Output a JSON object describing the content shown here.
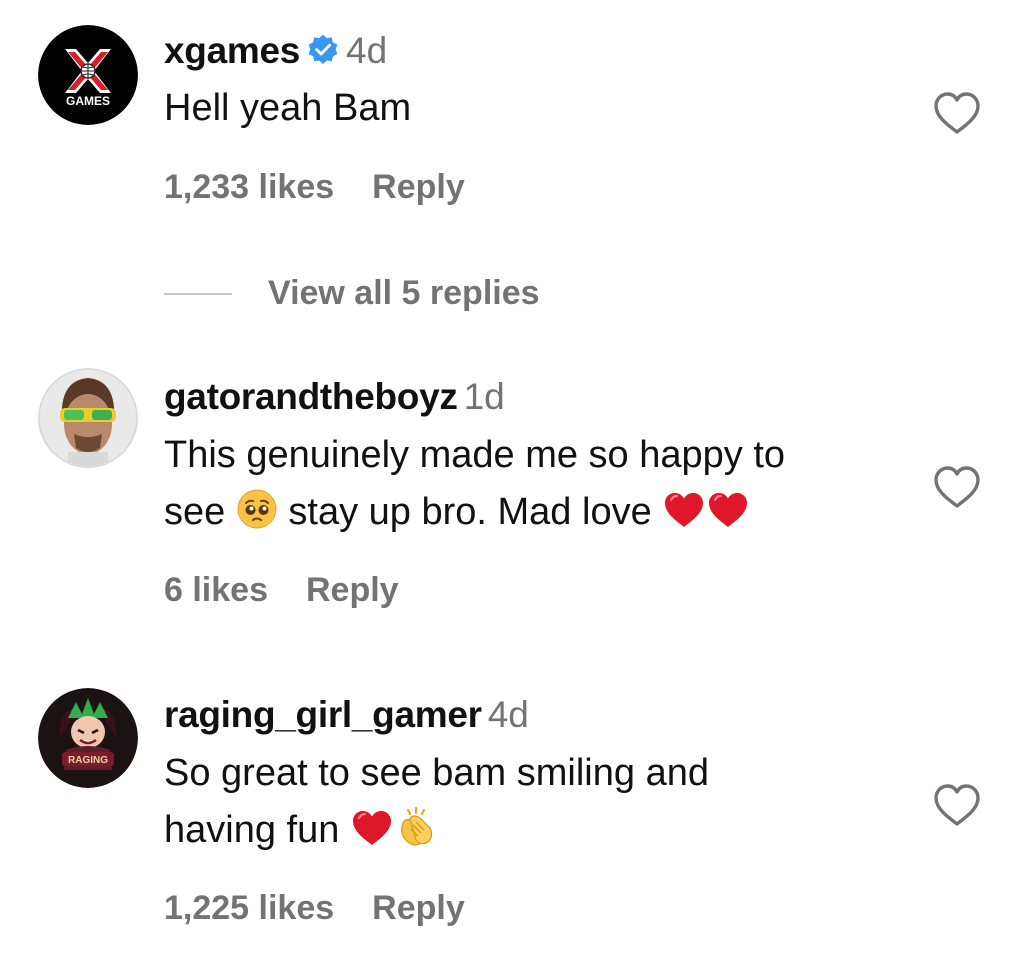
{
  "comments": [
    {
      "username": "xgames",
      "verified": true,
      "time": "4d",
      "text_lines": [
        "Hell yeah Bam"
      ],
      "likes": "1,233 likes",
      "reply_label": "Reply",
      "avatar_icon": "x-games-logo",
      "avatar_text": "GAMES"
    },
    {
      "username": "gatorandtheboyz",
      "verified": false,
      "time": "1d",
      "text_line1": "This genuinely made me so happy to",
      "text_line2_a": "see",
      "text_line2_b": "stay up bro. Mad love",
      "likes": "6 likes",
      "reply_label": "Reply",
      "avatar_icon": "man-with-sunglasses-avatar"
    },
    {
      "username": "raging_girl_gamer",
      "verified": false,
      "time": "4d",
      "text_line1": "So great to see bam smiling and",
      "text_line2": "having fun",
      "likes": "1,225 likes",
      "reply_label": "Reply",
      "avatar_icon": "raging-gamer-avatar",
      "avatar_text": "RAGING"
    }
  ],
  "view_replies": "View all 5 replies",
  "colors": {
    "text": "#111111",
    "secondary": "#737373",
    "verified": "#3897F0",
    "heart_red": "#E0162B"
  }
}
